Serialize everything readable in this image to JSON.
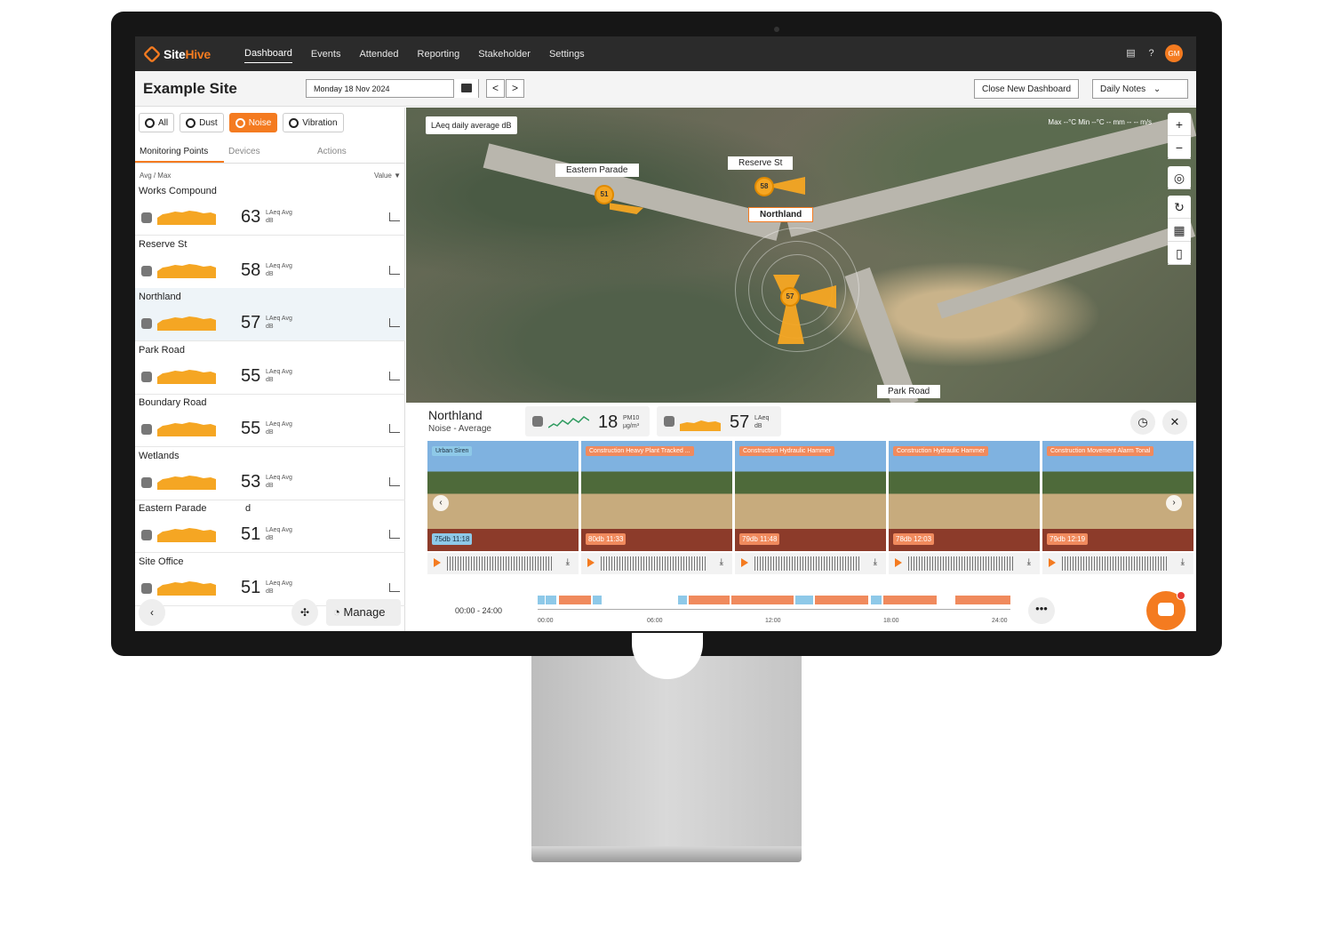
{
  "nav": {
    "brand_a": "Site",
    "brand_b": "Hive",
    "items": [
      "Dashboard",
      "Events",
      "Attended",
      "Reporting",
      "Stakeholder",
      "Settings"
    ],
    "avatar": "GM"
  },
  "header": {
    "site_title": "Example Site",
    "date": "Monday 18 Nov 2024",
    "prev": "<",
    "next": ">",
    "close_dashboard": "Close New Dashboard",
    "daily_notes": "Daily Notes"
  },
  "filters": [
    "All",
    "Dust",
    "Noise",
    "Vibration"
  ],
  "left_tabs": [
    "Monitoring Points",
    "Devices",
    "Actions"
  ],
  "list_header": {
    "avg_max": "Avg / Max",
    "value": "Value ▼"
  },
  "unit": {
    "sub": "LAeq",
    "avg": "Avg",
    "db": "dB"
  },
  "points": [
    {
      "name": "Works Compound",
      "value": "63"
    },
    {
      "name": "Reserve St",
      "value": "58"
    },
    {
      "name": "Northland",
      "value": "57"
    },
    {
      "name": "Park Road",
      "value": "55"
    },
    {
      "name": "Boundary Road",
      "value": "55"
    },
    {
      "name": "Wetlands",
      "value": "53"
    },
    {
      "name": "Eastern Parade",
      "value": "51",
      "extra": "d"
    },
    {
      "name": "Site Office",
      "value": "51"
    }
  ],
  "left_footer": {
    "manage": "Manage"
  },
  "map": {
    "title": "LAeq daily average dB",
    "weather": "Max --°C  Min --°C  -- mm  -- -- m/s",
    "labels": {
      "eastern": "Eastern Parade",
      "reserve": "Reserve St",
      "northland": "Northland",
      "park": "Park Road"
    },
    "markers": {
      "eastern": "51",
      "reserve": "58",
      "northland": "57"
    },
    "controls": [
      "+",
      "−"
    ]
  },
  "detail": {
    "title": "Northland",
    "subtitle": "Noise - Average",
    "dust_value": "18",
    "dust_unit_a": "PM10",
    "dust_unit_b": "µg/m³",
    "noise_value": "57",
    "noise_unit_a": "LAeq",
    "noise_unit_b": "dB",
    "clips": [
      {
        "tag": "Urban Siren",
        "time": "75db 11:18",
        "kind": "blue"
      },
      {
        "tag": "Construction Heavy Plant Tracked ...",
        "time": "80db 11:33",
        "kind": "orange"
      },
      {
        "tag": "Construction Hydraulic Hammer",
        "time": "79db 11:48",
        "kind": "orange"
      },
      {
        "tag": "Construction Hydraulic Hammer",
        "time": "78db 12:03",
        "kind": "orange"
      },
      {
        "tag": "Construction Movement Alarm Tonal",
        "time": "79db 12:19",
        "kind": "orange"
      }
    ],
    "range": "00:00 - 24:00",
    "ticks": [
      "00:00",
      "06:00",
      "12:00",
      "18:00",
      "24:00"
    ]
  },
  "colors": {
    "accent": "#f47b20",
    "amber": "#f5a623",
    "clip_blue": "#8ec9e8",
    "clip_orange": "#f08a5d"
  }
}
